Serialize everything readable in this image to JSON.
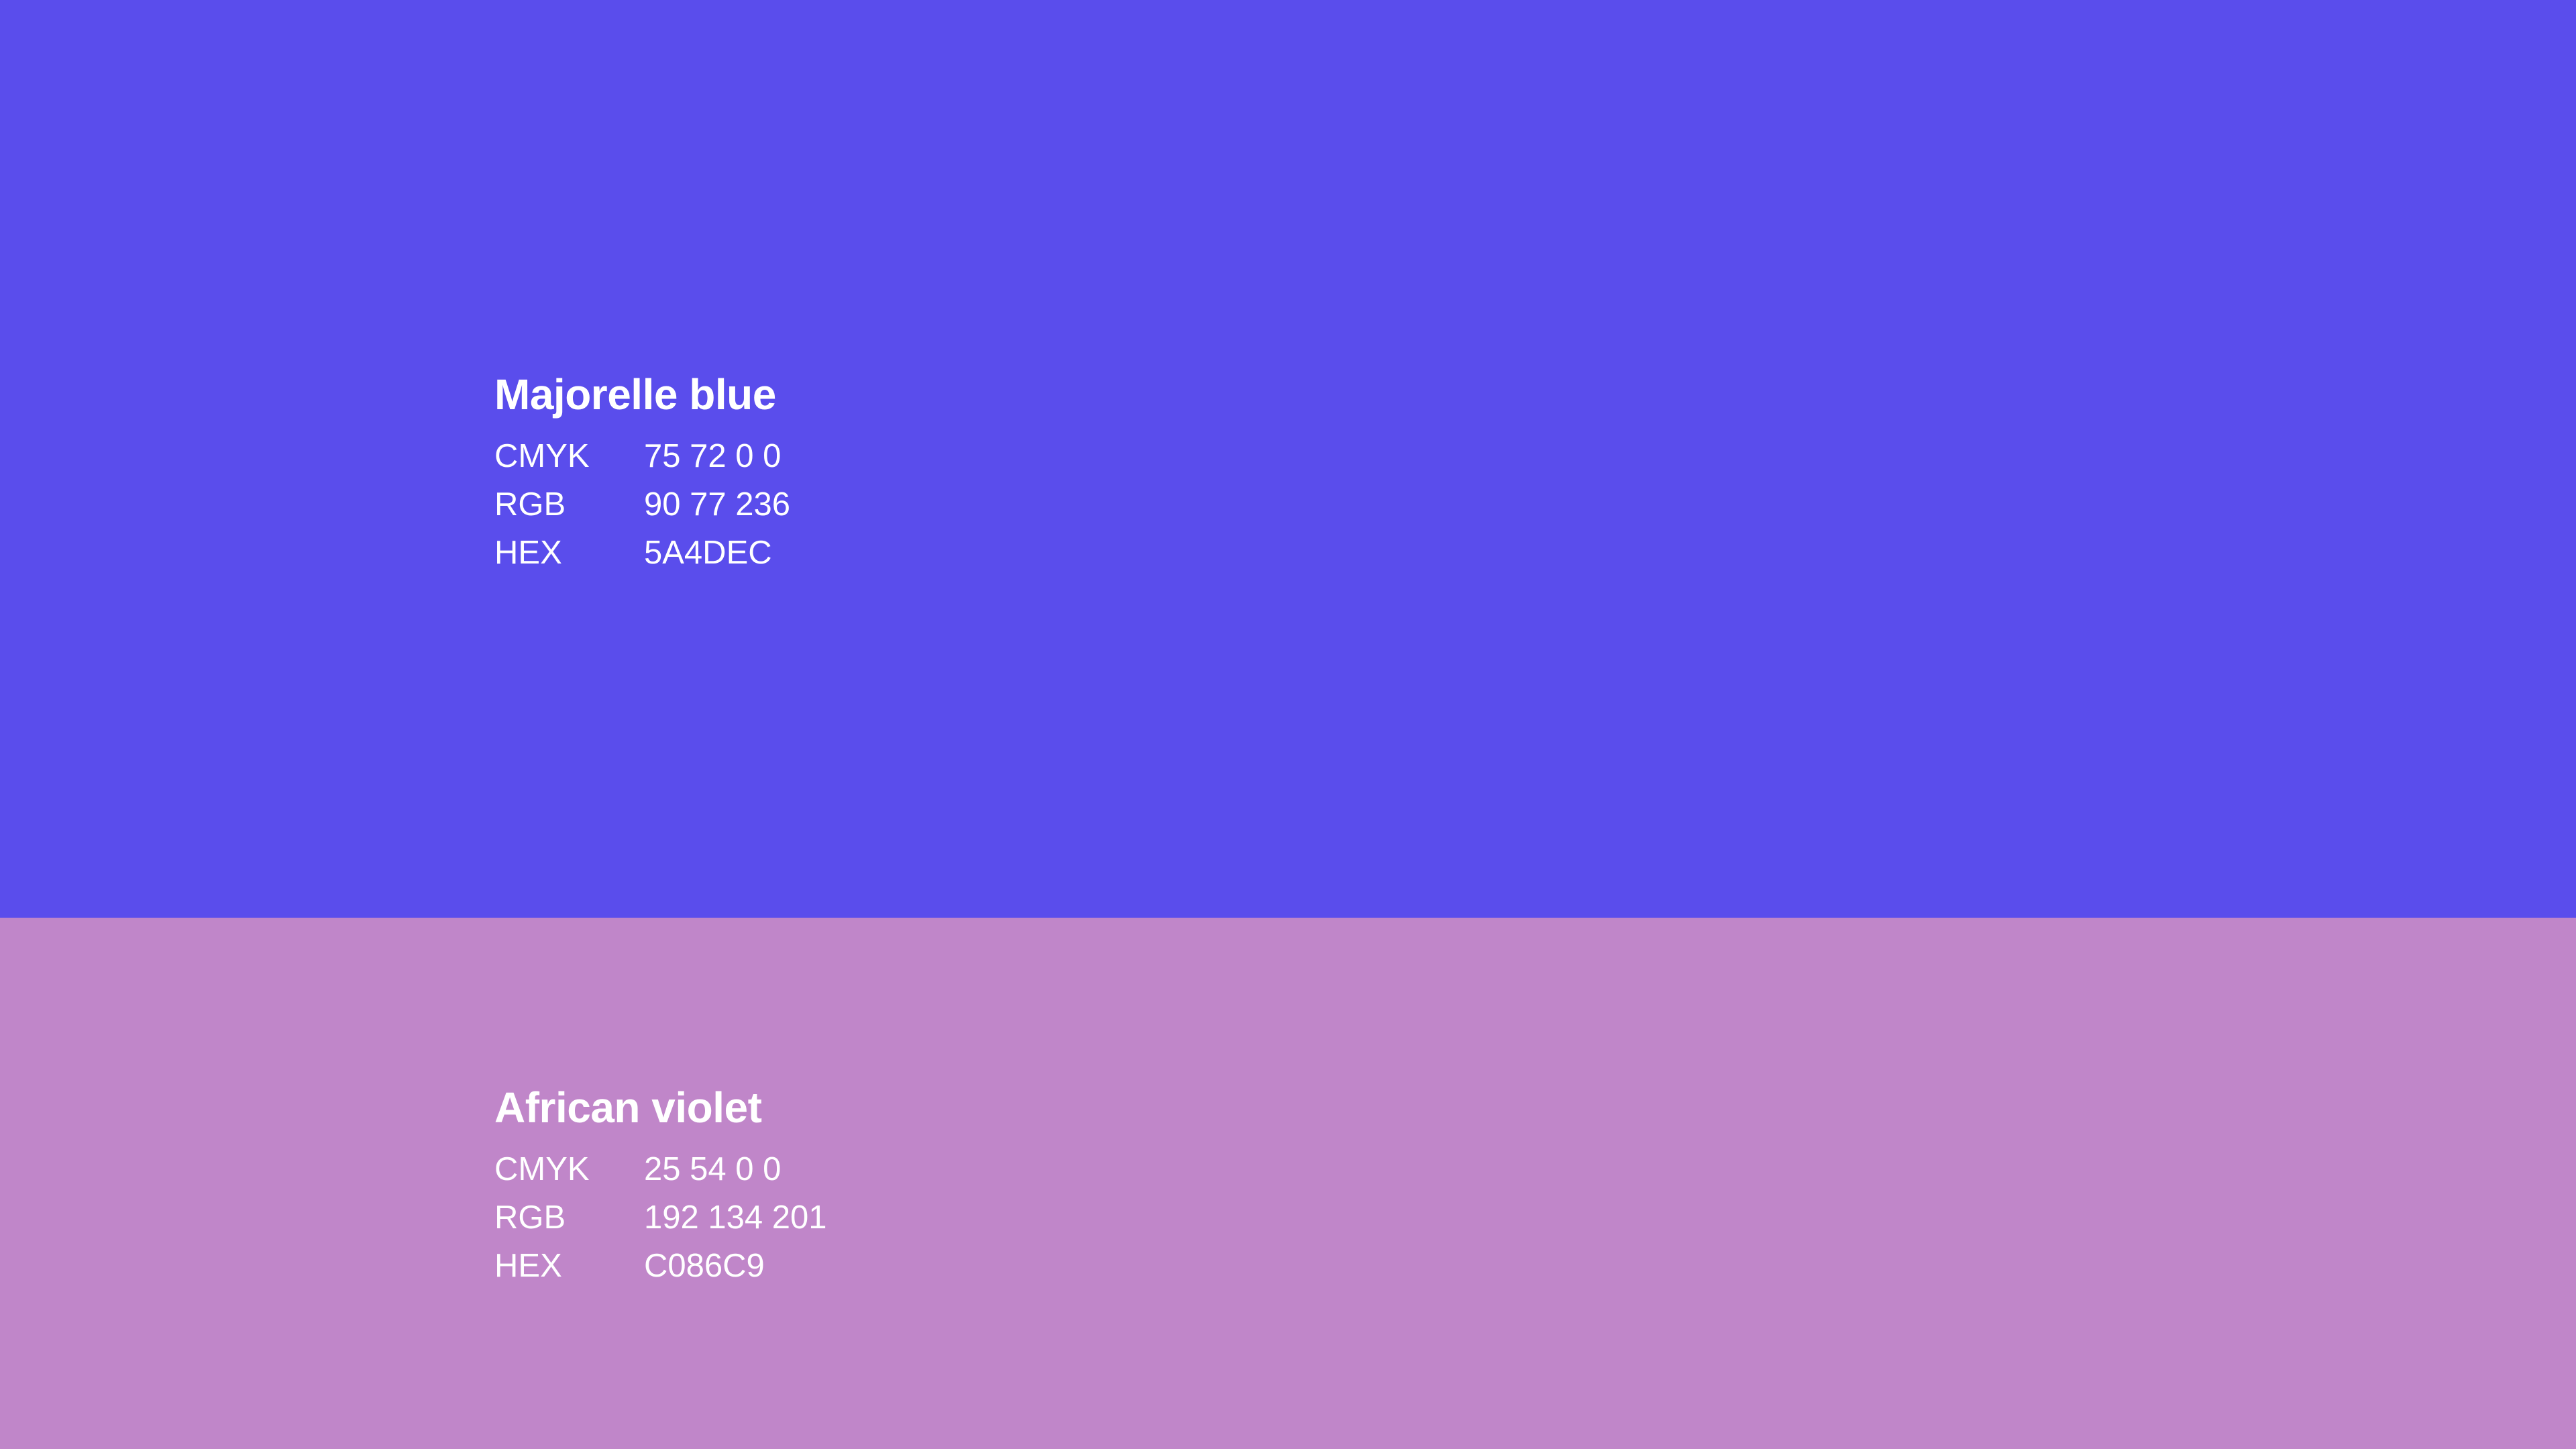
{
  "swatches": [
    {
      "name": "Majorelle blue",
      "color": "#5A4DEC",
      "values": [
        {
          "label": "CMYK",
          "value": "75 72 0 0"
        },
        {
          "label": "RGB",
          "value": "90 77 236"
        },
        {
          "label": "HEX",
          "value": "5A4DEC"
        }
      ]
    },
    {
      "name": "African violet",
      "color": "#C086C9",
      "values": [
        {
          "label": "CMYK",
          "value": "25 54 0 0"
        },
        {
          "label": "RGB",
          "value": "192 134 201"
        },
        {
          "label": "HEX",
          "value": "C086C9"
        }
      ]
    }
  ]
}
